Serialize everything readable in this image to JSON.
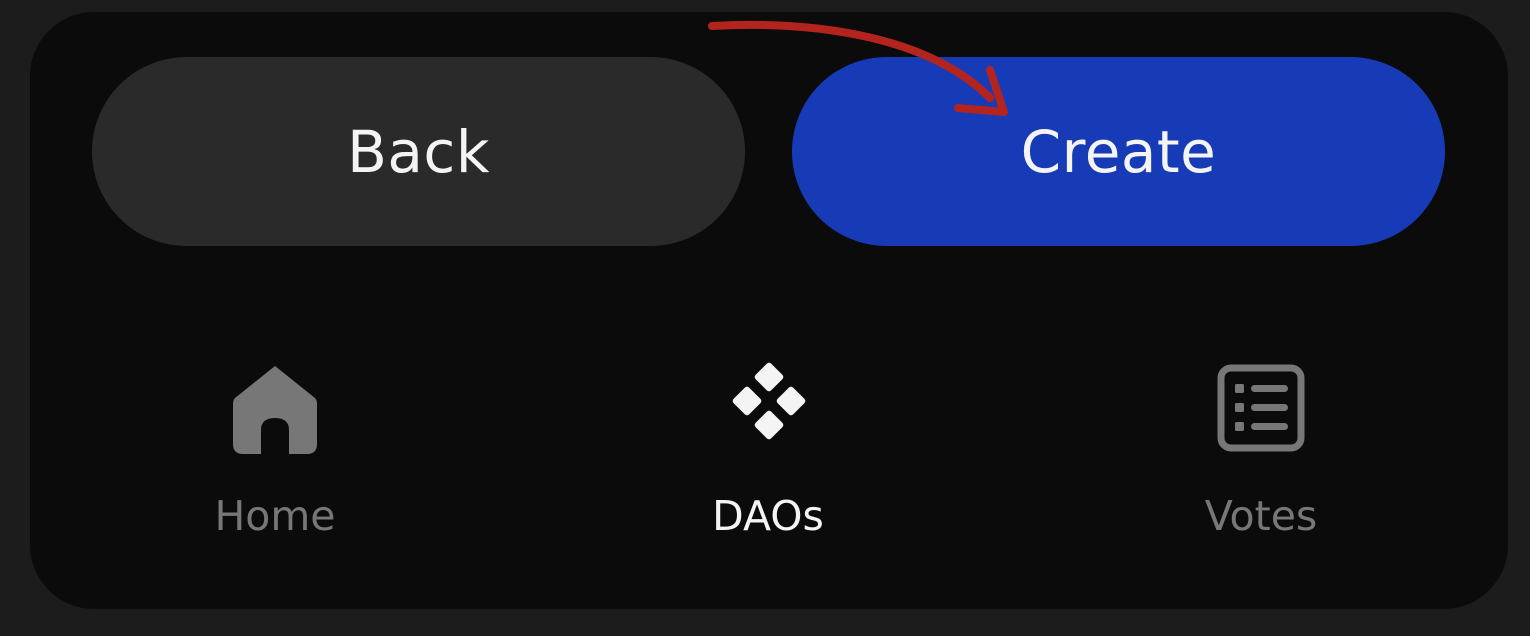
{
  "actions": {
    "back_label": "Back",
    "create_label": "Create"
  },
  "nav": {
    "items": [
      {
        "label": "Home",
        "icon": "home-icon",
        "active": false
      },
      {
        "label": "DAOs",
        "icon": "daos-icon",
        "active": true
      },
      {
        "label": "Votes",
        "icon": "votes-icon",
        "active": false
      }
    ]
  },
  "colors": {
    "background": "#1c1c1c",
    "panel": "#0b0b0b",
    "back_button": "#2a2a2a",
    "create_button": "#173bb6",
    "active_text": "#f4f4f4",
    "inactive": "#777777",
    "annotation_arrow": "#b3241f"
  }
}
